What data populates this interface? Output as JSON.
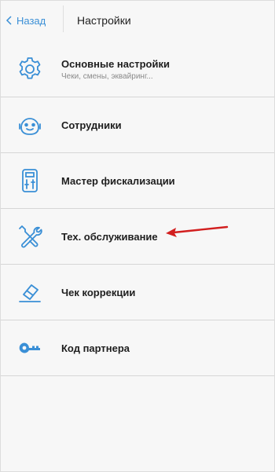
{
  "header": {
    "back_label": "Назад",
    "title": "Настройки"
  },
  "menu": {
    "items": [
      {
        "title": "Основные настройки",
        "subtitle": "Чеки, смены, эквайринг...",
        "icon": "gear-icon"
      },
      {
        "title": "Сотрудники",
        "icon": "employee-face-icon"
      },
      {
        "title": "Мастер фискализации",
        "icon": "fiscal-device-icon"
      },
      {
        "title": "Тех. обслуживание",
        "icon": "tools-icon"
      },
      {
        "title": "Чек коррекции",
        "icon": "eraser-icon"
      },
      {
        "title": "Код партнера",
        "icon": "key-icon"
      }
    ]
  },
  "colors": {
    "accent": "#3a8fd6",
    "annotation_arrow": "#d21f1f",
    "background": "#f7f7f7",
    "divider": "#d6d6d6"
  }
}
